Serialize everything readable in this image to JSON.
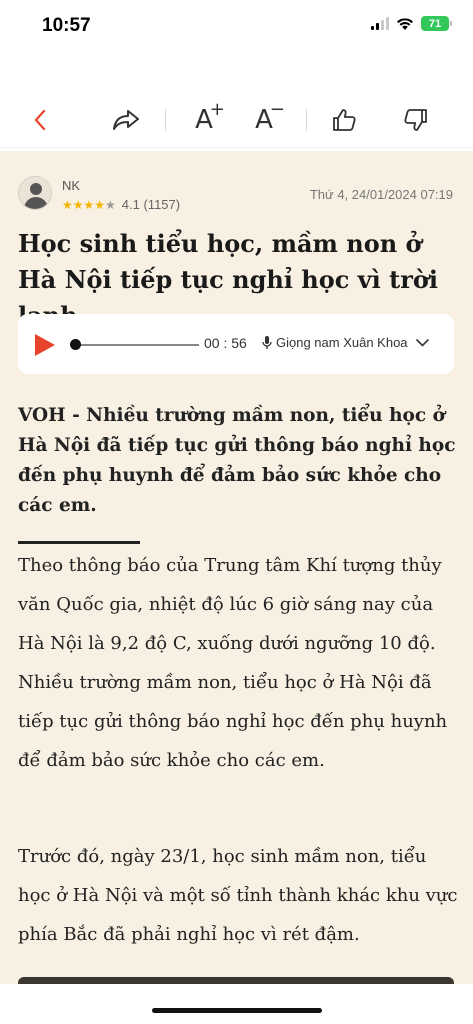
{
  "status_bar": {
    "time": "10:57",
    "battery": "71"
  },
  "toolbar": {
    "back_icon": "chevron-left-icon",
    "share_icon": "share-arrow-icon",
    "font_increase": "A",
    "font_increase_sup": "+",
    "font_decrease": "A",
    "font_decrease_sup": "−",
    "like_icon": "thumbs-up-icon",
    "dislike_icon": "thumbs-down-icon"
  },
  "article": {
    "author": "NK",
    "stars_filled": 4,
    "stars_total": 5,
    "rating": "4.1 (1157)",
    "date": "Thứ 4, 24/01/2024 07:19",
    "title": "Học sinh tiểu học, mầm non ở Hà Nội tiếp tục nghỉ học vì trời lạnh",
    "audio": {
      "duration": "00 : 56",
      "voice": "Giọng nam Xuân Khoa",
      "progress": 0
    },
    "lead": "VOH - Nhiều trường mầm non, tiểu học ở Hà Nội đã tiếp tục gửi thông báo nghỉ học đến phụ huynh để đảm bảo sức khỏe cho các em.",
    "paragraphs": [
      "Theo thông báo của Trung tâm Khí tượng thủy văn Quốc gia, nhiệt độ lúc 6 giờ sáng nay của Hà Nội là 9,2 độ C, xuống dưới ngưỡng 10 độ. Nhiều trường mầm non, tiểu học ở Hà Nội đã tiếp tục gửi thông báo nghỉ học đến phụ huynh để đảm bảo sức khỏe cho các em.",
      "Trước đó, ngày 23/1, học sinh mầm non, tiểu học ở Hà Nội và một số tỉnh thành khác khu vực phía Bắc đã phải nghỉ học vì rét đậm."
    ]
  },
  "colors": {
    "accent": "#e8442c",
    "background": "#f7f0e3",
    "star": "#f5b301"
  }
}
